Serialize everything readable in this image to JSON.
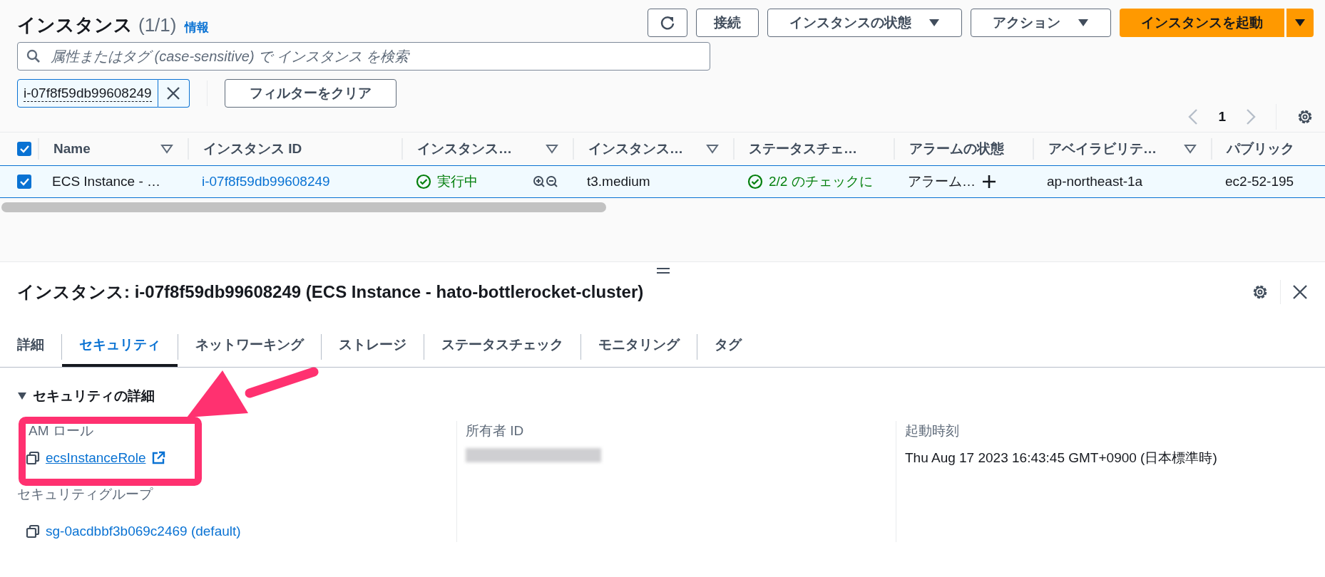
{
  "header": {
    "title": "インスタンス",
    "count": "(1/1)",
    "info_link": "情報"
  },
  "toolbar": [
    {
      "kind": "refresh"
    },
    {
      "kind": "plain",
      "label": "接続"
    },
    {
      "kind": "dropdown",
      "label": "インスタンスの状態"
    },
    {
      "kind": "dropdown",
      "label": "アクション"
    },
    {
      "kind": "primary-split",
      "label": "インスタンスを起動"
    }
  ],
  "search": {
    "placeholder": "属性またはタグ (case-sensitive) で インスタンス を検索"
  },
  "filter_token": {
    "value": "i-07f8f59db99608249"
  },
  "clear_filters": "フィルターをクリア",
  "pagination": {
    "page": "1"
  },
  "table": {
    "all_checked": true,
    "columns": [
      {
        "label": "Name",
        "sortable": true
      },
      {
        "label": "インスタンス ID",
        "sortable": false
      },
      {
        "label": "インスタンス…",
        "sortable": true
      },
      {
        "label": "インスタンス…",
        "sortable": true
      },
      {
        "label": "ステータスチェ…",
        "sortable": false
      },
      {
        "label": "アラームの状態",
        "sortable": false
      },
      {
        "label": "アベイラビリテ…",
        "sortable": true
      },
      {
        "label": "パブリック",
        "sortable": false
      }
    ],
    "rows": [
      {
        "checked": true,
        "selected": true,
        "cells": [
          {
            "kind": "text",
            "text": "ECS Instance - …"
          },
          {
            "kind": "link",
            "text": "i-07f8f59db99608249"
          },
          {
            "kind": "state",
            "text": "実行中"
          },
          {
            "kind": "text",
            "text": "t3.medium"
          },
          {
            "kind": "check",
            "text": "2/2 のチェックに"
          },
          {
            "kind": "alarm",
            "text": "アラーム…"
          },
          {
            "kind": "text",
            "text": "ap-northeast-1a"
          },
          {
            "kind": "text",
            "text": "ec2-52-195"
          }
        ]
      }
    ]
  },
  "details": {
    "title": "インスタンス: i-07f8f59db99608249 (ECS Instance - hato-bottlerocket-cluster)",
    "tabs": [
      {
        "label": "詳細",
        "selected": false
      },
      {
        "label": "セキュリティ",
        "selected": true
      },
      {
        "label": "ネットワーキング",
        "selected": false
      },
      {
        "label": "ストレージ",
        "selected": false
      },
      {
        "label": "ステータスチェック",
        "selected": false
      },
      {
        "label": "モニタリング",
        "selected": false
      },
      {
        "label": "タグ",
        "selected": false
      }
    ],
    "section": {
      "title": "セキュリティの詳細",
      "expanded": true
    },
    "columns": [
      [
        {
          "label": "AM ロール",
          "value": "ecsInstanceRole",
          "kind": "external-link"
        },
        {
          "label": "セキュリティグループ",
          "value": "sg-0acdbbf3b069c2469 (default)",
          "kind": "copy-link"
        }
      ],
      [
        {
          "label": "所有者 ID",
          "kind": "redacted"
        }
      ],
      [
        {
          "label": "起動時刻",
          "value": "Thu Aug 17 2023 16:43:45 GMT+0900 (日本標準時)",
          "kind": "text"
        }
      ]
    ]
  },
  "arrow": {
    "color": "#ff3170"
  },
  "highlight_frame": {
    "color": "#ff3170"
  }
}
